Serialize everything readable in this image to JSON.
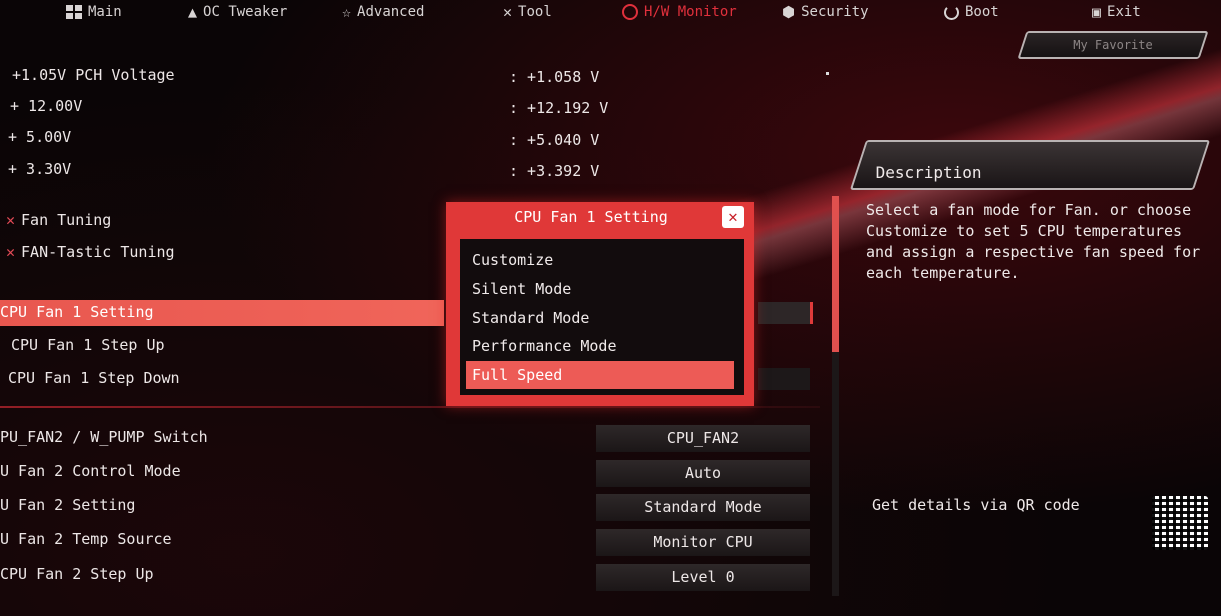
{
  "nav": {
    "items": [
      {
        "label": "Main",
        "icon": "grid-icon"
      },
      {
        "label": "OC Tweaker",
        "icon": "rocket-icon"
      },
      {
        "label": "Advanced",
        "icon": "star-icon"
      },
      {
        "label": "Tool",
        "icon": "wrench-icon"
      },
      {
        "label": "H/W Monitor",
        "icon": "monitor-icon",
        "active": true
      },
      {
        "label": "Security",
        "icon": "shield-icon"
      },
      {
        "label": "Boot",
        "icon": "power-icon"
      },
      {
        "label": "Exit",
        "icon": "exit-icon"
      }
    ],
    "favorite": "My Favorite"
  },
  "voltages": [
    {
      "label": "+1.05V PCH Voltage",
      "value": ": +1.058 V"
    },
    {
      "label": "+ 12.00V",
      "value": ": +12.192 V"
    },
    {
      "label": "+ 5.00V",
      "value": ": +5.040 V"
    },
    {
      "label": "+ 3.30V",
      "value": ": +3.392 V"
    }
  ],
  "tools": [
    {
      "label": "Fan Tuning"
    },
    {
      "label": "FAN-Tastic Tuning"
    }
  ],
  "fan1": {
    "setting": "CPU Fan 1 Setting",
    "step_up": "CPU Fan 1 Step Up",
    "step_down": "CPU Fan 1 Step Down"
  },
  "fan2_rows": [
    {
      "label": "PU_FAN2 / W_PUMP Switch",
      "value": "CPU_FAN2"
    },
    {
      "label": "U Fan 2 Control Mode",
      "value": "Auto"
    },
    {
      "label": "U Fan 2 Setting",
      "value": "Standard Mode"
    },
    {
      "label": "U Fan 2 Temp Source",
      "value": "Monitor CPU"
    },
    {
      "label": "CPU Fan 2 Step Up",
      "value": "Level 0"
    }
  ],
  "popup": {
    "title": "CPU Fan 1 Setting",
    "options": [
      "Customize",
      "Silent Mode",
      "Standard Mode",
      "Performance Mode",
      "Full Speed"
    ],
    "selected_index": 4
  },
  "description": {
    "title": "Description",
    "text": "Select a fan mode for Fan. or choose Customize to set 5 CPU temperatures and assign a respective fan speed for each temperature.",
    "qr_label": "Get details via QR code"
  },
  "colors": {
    "accent": "#e03838",
    "highlight": "#ed5b56"
  }
}
